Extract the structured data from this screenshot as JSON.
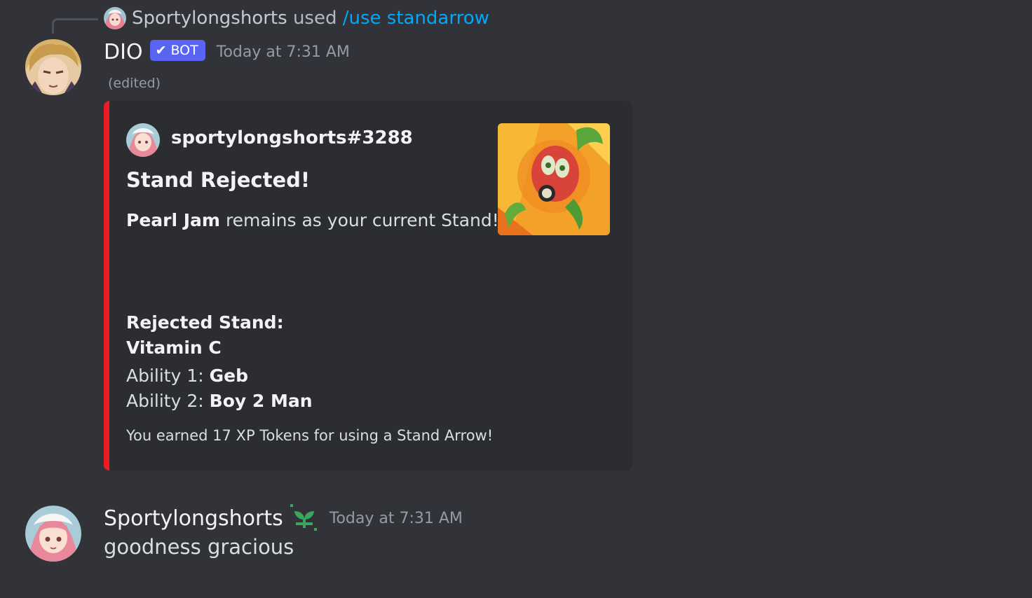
{
  "reply": {
    "user": "Sportylongshorts",
    "used_text": "used",
    "command": "/use standarrow"
  },
  "bot_message": {
    "username": "DIO",
    "badge": "BOT",
    "timestamp": "Today at 7:31 AM",
    "edited": "(edited)",
    "embed": {
      "accent_color": "#ed1c24",
      "author": "sportylongshorts#3288",
      "title": "Stand Rejected!",
      "description_bold": "Pearl Jam",
      "description_rest": "remains as your current Stand!",
      "rejected_label": "Rejected Stand:",
      "rejected_name": "Vitamin C",
      "ability1_label": "Ability 1:",
      "ability1_value": "Geb",
      "ability2_label": "Ability 2:",
      "ability2_value": "Boy 2 Man",
      "footer": "You earned 17 XP Tokens for using a Stand Arrow!"
    }
  },
  "user_message": {
    "username": "Sportylongshorts",
    "badge_icon": "sprout-icon",
    "timestamp": "Today at 7:31 AM",
    "text": "goodness gracious"
  }
}
